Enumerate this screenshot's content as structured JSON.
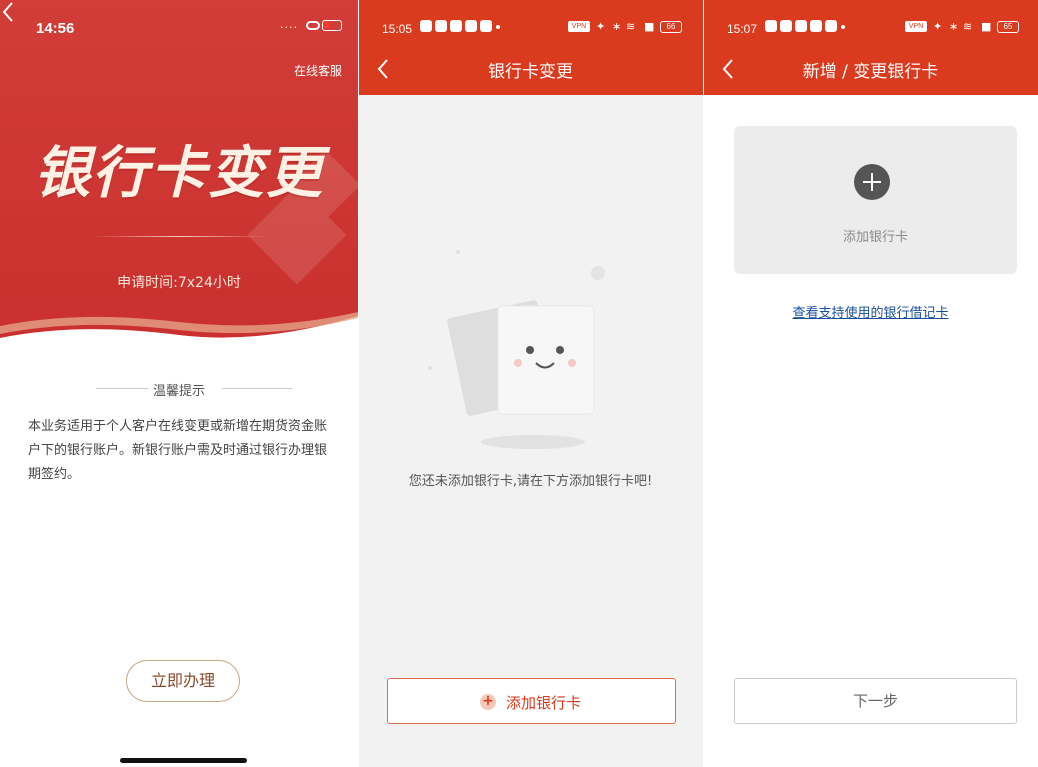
{
  "panel1": {
    "status_time": "14:56",
    "service_link": "在线客服",
    "hero_title": "银行卡变更",
    "hours": "申请时间:7x24小时",
    "tip_title": "温馨提示",
    "tip_body": "本业务适用于个人客户在线变更或新增在期货资金账户下的银行账户。新银行账户需及时通过银行办理银期签约。",
    "action_button": "立即办理",
    "colors": {
      "hero_red": "#d03a36",
      "button_border": "#c8a887"
    }
  },
  "panel2": {
    "status_time": "15:05",
    "battery": "66",
    "title": "银行卡变更",
    "empty_message": "您还未添加银行卡,请在下方添加银行卡吧!",
    "add_button": "添加银行卡",
    "colors": {
      "appbar": "#da3a1e",
      "background": "#f2f2f2"
    }
  },
  "panel3": {
    "status_time": "15:07",
    "battery": "65",
    "title": "新增 / 变更银行卡",
    "add_card_label": "添加银行卡",
    "supported_cards_link": "查看支持使用的银行借记卡",
    "next_button": "下一步",
    "colors": {
      "link": "#1a4f9c"
    }
  }
}
